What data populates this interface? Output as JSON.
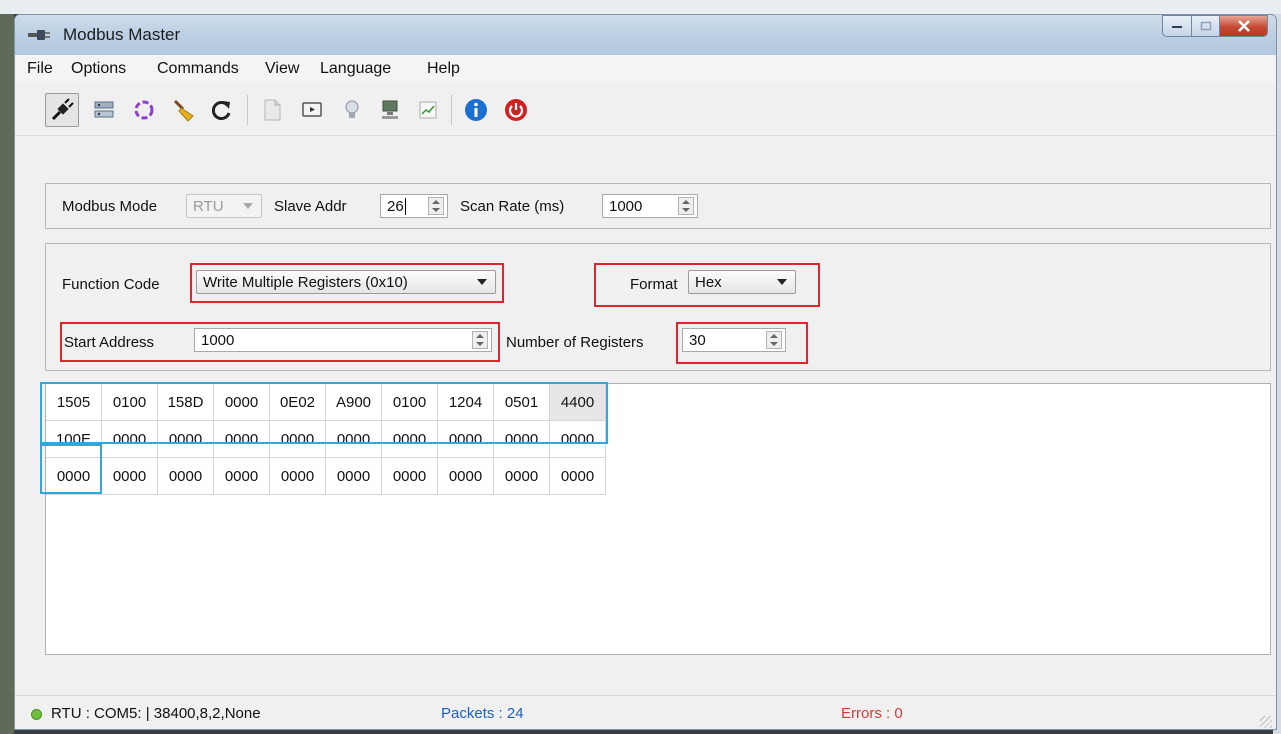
{
  "window": {
    "title": "Modbus Master"
  },
  "menu": [
    "File",
    "Options",
    "Commands",
    "View",
    "Language",
    "Help"
  ],
  "toolbar": {
    "icons": [
      "connect-icon",
      "network-settings-icon",
      "loop-icon",
      "clear-icon",
      "refresh-icon",
      "document-icon",
      "monitor-icon",
      "light-bulb-icon",
      "computer-icon",
      "chart-icon",
      "info-icon",
      "power-icon"
    ],
    "colors": {
      "info": "#1a6fd1",
      "power": "#d02020",
      "clear": "#e8b020"
    }
  },
  "connection": {
    "mode_label": "Modbus Mode",
    "mode_value": "RTU",
    "slave_label": "Slave Addr",
    "slave_value": "26",
    "scan_label": "Scan Rate (ms)",
    "scan_value": "1000"
  },
  "request": {
    "function_label": "Function Code",
    "function_value": "Write Multiple Registers (0x10)",
    "format_label": "Format",
    "format_value": "Hex",
    "start_label": "Start Address",
    "start_value": "1000",
    "count_label": "Number of Registers",
    "count_value": "30"
  },
  "registers": [
    [
      "1505",
      "0100",
      "158D",
      "0000",
      "0E02",
      "A900",
      "0100",
      "1204",
      "0501",
      "4400"
    ],
    [
      "100E",
      "0000",
      "0000",
      "0000",
      "0000",
      "0000",
      "0000",
      "0000",
      "0000",
      "0000"
    ],
    [
      "0000",
      "0000",
      "0000",
      "0000",
      "0000",
      "0000",
      "0000",
      "0000",
      "0000",
      "0000"
    ]
  ],
  "status": {
    "port": "RTU : COM5: | 38400,8,2,None",
    "packets": "Packets : 24",
    "errors": "Errors : 0",
    "colors": {
      "packets": "#1f5fb8",
      "errors": "#d23a3a",
      "led": "#6fbf3a"
    }
  }
}
